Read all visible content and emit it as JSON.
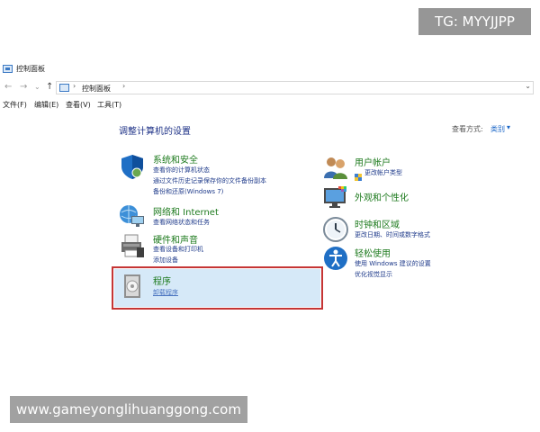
{
  "window": {
    "title": "控制面板"
  },
  "nav": {
    "back_glyph": "←",
    "forward_glyph": "→",
    "recent_glyph": "⌄",
    "up_glyph": "↑",
    "breadcrumb": "控制面板",
    "separator": "›",
    "dropdown_glyph": "⌄"
  },
  "menu": {
    "items": [
      {
        "label": "文件(F)"
      },
      {
        "label": "编辑(E)"
      },
      {
        "label": "查看(V)"
      },
      {
        "label": "工具(T)"
      }
    ]
  },
  "content": {
    "heading": "调整计算机的设置",
    "view_by_label": "查看方式:",
    "view_by_value": "类别",
    "view_by_arrow": "▾"
  },
  "categories_left": [
    {
      "title": "系统和安全",
      "icon": "shield-icon",
      "links": [
        "查看你的计算机状态",
        "通过文件历史记录保存你的文件备份副本",
        "备份和还原(Windows 7)"
      ]
    },
    {
      "title": "网络和 Internet",
      "icon": "network-icon",
      "links": [
        "查看网络状态和任务"
      ]
    },
    {
      "title": "硬件和声音",
      "icon": "printer-icon",
      "links": [
        "查看设备和打印机",
        "添加设备"
      ]
    },
    {
      "title": "程序",
      "icon": "programs-icon",
      "links": [
        "卸载程序"
      ]
    }
  ],
  "categories_right": [
    {
      "title": "用户帐户",
      "icon": "users-icon",
      "links": [
        "更改帐户类型"
      ]
    },
    {
      "title": "外观和个性化",
      "icon": "appearance-icon",
      "links": []
    },
    {
      "title": "时钟和区域",
      "icon": "clock-icon",
      "links": [
        "更改日期、时间或数字格式"
      ]
    },
    {
      "title": "轻松使用",
      "icon": "ease-of-access-icon",
      "links": [
        "使用 Windows 建议的设置",
        "优化视觉显示"
      ]
    }
  ],
  "watermarks": {
    "tg": "TG: MYYJJPP",
    "site": "www.gameyonglihuanggong.com"
  },
  "colors": {
    "category_title": "#1d7a1d",
    "link": "#1e3a8a",
    "heading": "#1e3287",
    "highlight_border": "#c53535",
    "highlight_fill": "#d6e9f8"
  }
}
